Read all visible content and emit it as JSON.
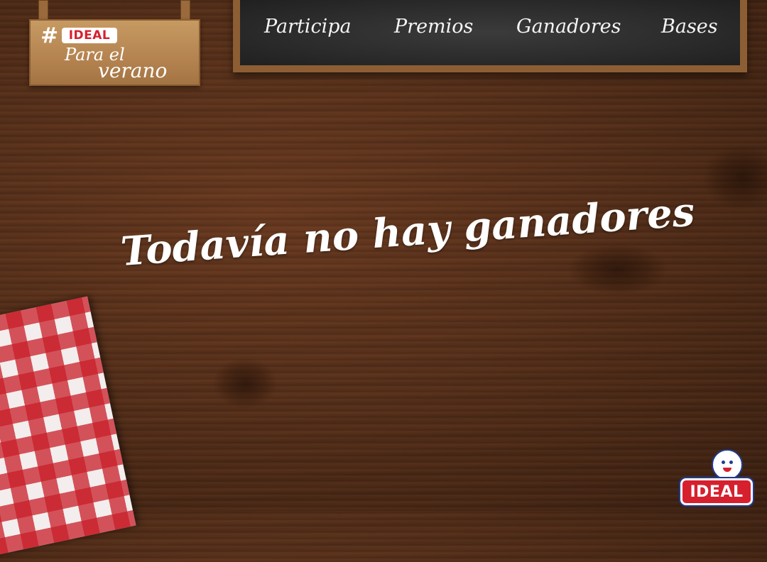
{
  "sign": {
    "hash": "#",
    "brand": "IDEAL",
    "line1": "Para el",
    "line2": "verano"
  },
  "nav": {
    "items": [
      {
        "label": "Participa"
      },
      {
        "label": "Premios"
      },
      {
        "label": "Ganadores"
      },
      {
        "label": "Bases"
      }
    ]
  },
  "main": {
    "headline": "Todavía no hay ganadores"
  },
  "footer_logo": {
    "brand": "IDEAL"
  },
  "colors": {
    "brand_red": "#d6202e",
    "brand_blue": "#1f3c8f",
    "chalkboard": "#2b2b2b",
    "wood": "#57301a"
  },
  "icons": {
    "logo_mascot": "mascot-icon"
  }
}
